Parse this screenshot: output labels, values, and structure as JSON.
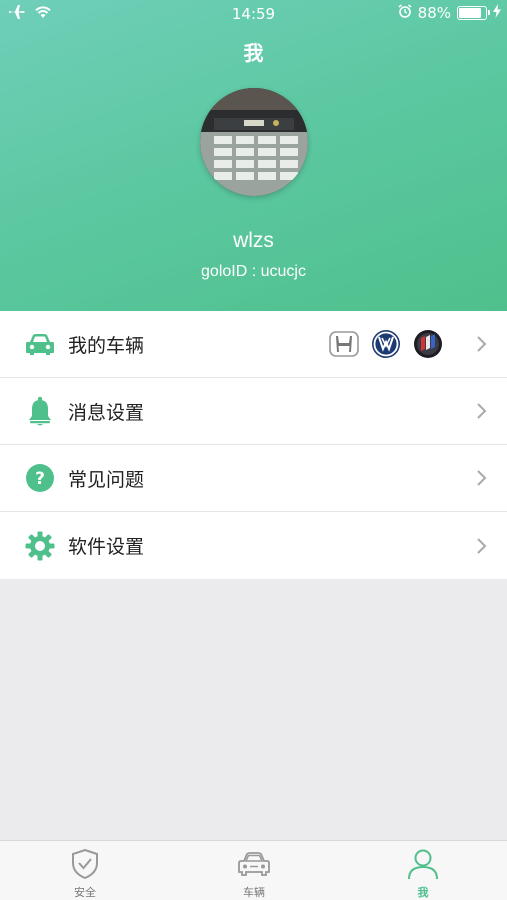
{
  "status_bar": {
    "time": "14:59",
    "battery_text": "88%",
    "battery_level": 0.88
  },
  "header": {
    "title": "我",
    "username": "wlzs",
    "golo_id": "goloID : ucucjc"
  },
  "menu": [
    {
      "label": "我的车辆",
      "icon": "car-icon"
    },
    {
      "label": "消息设置",
      "icon": "bell-icon"
    },
    {
      "label": "常见问题",
      "icon": "question-icon"
    },
    {
      "label": "软件设置",
      "icon": "gear-icon"
    }
  ],
  "vehicle_brands": [
    "honda-logo",
    "volkswagen-logo",
    "buick-logo"
  ],
  "tabbar": {
    "tabs": [
      {
        "label": "安全",
        "icon": "shield-icon",
        "active": false
      },
      {
        "label": "车辆",
        "icon": "car-icon",
        "active": false
      },
      {
        "label": "我",
        "icon": "person-icon",
        "active": true
      }
    ]
  },
  "colors": {
    "accent": "#4fc08c",
    "header_gradient_start": "#6fcfb9",
    "header_gradient_end": "#4fc08c",
    "background": "#ebebed"
  }
}
